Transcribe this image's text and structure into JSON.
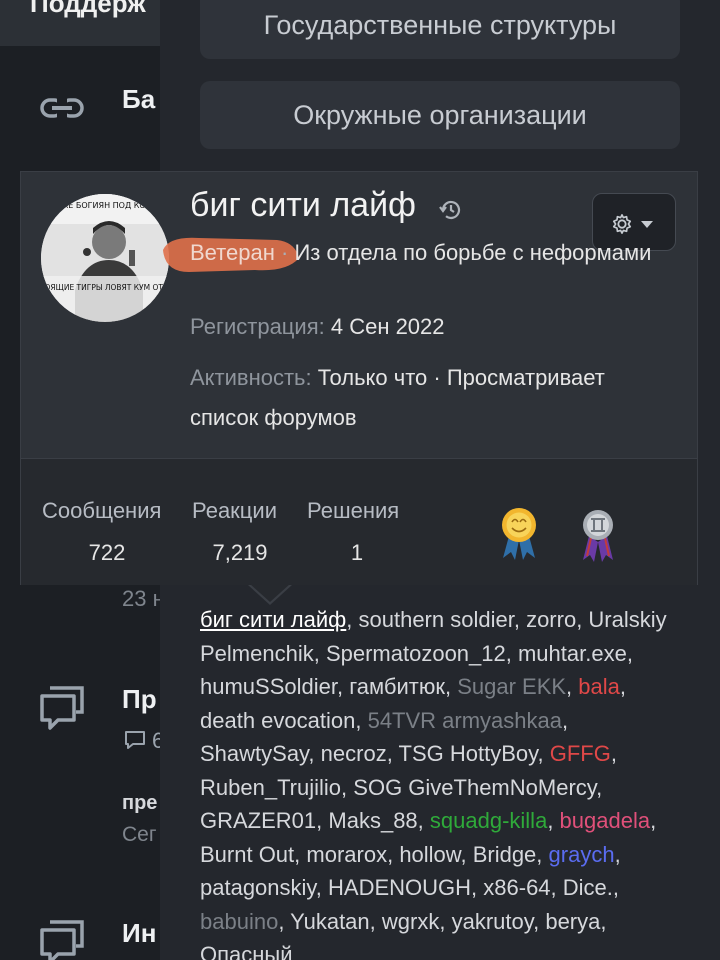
{
  "left_column": {
    "header_text": "Поддерж",
    "item1_text": "Ба",
    "item2_time": "23 н",
    "item3_text": "Пр",
    "item3_sub": "6",
    "item3_bold": "пре",
    "item3_date": "Сег",
    "item4_text": "Ин"
  },
  "menu": {
    "item_state": "Государственные структуры",
    "item_district": "Окружные организации"
  },
  "profile": {
    "username": "биг сити лайф",
    "title": "Ветеран",
    "separator": "·",
    "location": "Из отдела по борьбе с неформами",
    "registration_label": "Регистрация:",
    "registration_value": "4 Сен 2022",
    "activity_label": "Активность:",
    "activity_value": "Только что · Просматривает список форумов",
    "stats": {
      "messages_label": "Сообщения",
      "messages_value": "722",
      "reactions_label": "Реакции",
      "reactions_value": "7,219",
      "solutions_label": "Решения",
      "solutions_value": "1"
    },
    "avatar_text_top": "ДЖАДЖЕ БОГИЯН ПОД КОШЛАКА",
    "avatar_text_bottom": "НАСТОЯЩИЕ ТИГРЫ ЛОВЯТ КУМ ОТ ГУФА",
    "title_highlight_color": "#e0704a",
    "gear_icon": "gear-icon",
    "history_icon": "history-icon"
  },
  "online_users": [
    {
      "name": "биг сити лайф",
      "color": "#ffffff",
      "underline": true
    },
    {
      "name": "southern soldier",
      "color": "#d6d8dc"
    },
    {
      "name": "zorro",
      "color": "#d6d8dc"
    },
    {
      "name": "Uralskiy Pelmenchik",
      "color": "#d6d8dc"
    },
    {
      "name": "Spermatozoon_12",
      "color": "#d6d8dc"
    },
    {
      "name": "muhtar.exe",
      "color": "#d6d8dc"
    },
    {
      "name": "humuSSoldier",
      "color": "#d6d8dc"
    },
    {
      "name": "гамбитюк",
      "color": "#d6d8dc"
    },
    {
      "name": "Sugar EKK",
      "color": "#7b8087"
    },
    {
      "name": "bala",
      "color": "#e04848"
    },
    {
      "name": "death evocation",
      "color": "#d6d8dc"
    },
    {
      "name": "54TVR armyashkaa",
      "color": "#7b8087"
    },
    {
      "name": "ShawtySay",
      "color": "#d6d8dc"
    },
    {
      "name": "necroz",
      "color": "#d6d8dc"
    },
    {
      "name": "TSG HottyBoy",
      "color": "#d6d8dc"
    },
    {
      "name": "GFFG",
      "color": "#e04848"
    },
    {
      "name": "Ruben_Trujilio",
      "color": "#d6d8dc"
    },
    {
      "name": "SOG GiveThemNoMercy",
      "color": "#d6d8dc"
    },
    {
      "name": "GRAZER01",
      "color": "#d6d8dc"
    },
    {
      "name": "Maks_88",
      "color": "#d6d8dc"
    },
    {
      "name": "squadg-killa",
      "color": "#2faa3a"
    },
    {
      "name": "bugadela",
      "color": "#e0507a"
    },
    {
      "name": "Burnt Out",
      "color": "#d6d8dc"
    },
    {
      "name": "morarox",
      "color": "#d6d8dc"
    },
    {
      "name": "hollow",
      "color": "#d6d8dc"
    },
    {
      "name": "Bridge",
      "color": "#d6d8dc"
    },
    {
      "name": "graych",
      "color": "#5a6cf0"
    },
    {
      "name": "patagonskiy",
      "color": "#d6d8dc"
    },
    {
      "name": "HADENOUGH",
      "color": "#d6d8dc"
    },
    {
      "name": "x86-64",
      "color": "#d6d8dc"
    },
    {
      "name": "Dice.",
      "color": "#d6d8dc"
    },
    {
      "name": "babuino",
      "color": "#7b8087"
    },
    {
      "name": "Yukatan",
      "color": "#d6d8dc"
    },
    {
      "name": "wgrxk",
      "color": "#d6d8dc"
    },
    {
      "name": "yakrutoy",
      "color": "#d6d8dc"
    },
    {
      "name": "berya",
      "color": "#d6d8dc"
    },
    {
      "name": "Опасный",
      "color": "#d6d8dc"
    }
  ]
}
